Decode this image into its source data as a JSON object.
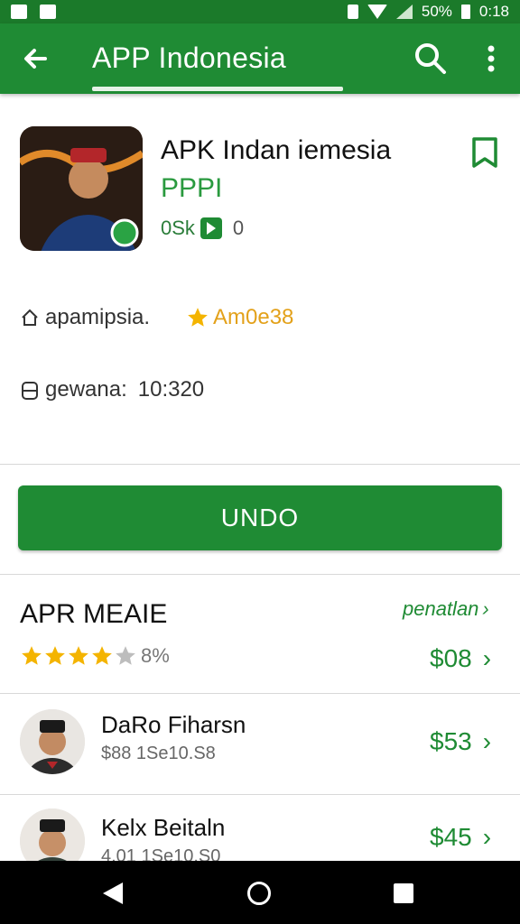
{
  "status_bar": {
    "battery_percent": "50%",
    "time": "0:18"
  },
  "app_bar": {
    "title": "APP Indonesia",
    "icons": [
      "back-arrow-icon",
      "search-icon",
      "more-vert-icon"
    ]
  },
  "app": {
    "name": "APK Indan iemesia",
    "developer": "PPPI",
    "badge_text": "0Sk",
    "badge_count": "0",
    "meta1_label": "apamipsia.",
    "meta1_rating": "Am0e38",
    "meta2_label": "gewana:",
    "meta2_value": "10:320"
  },
  "install_button": {
    "label": "UNDO"
  },
  "reviews_section": {
    "title": "APR MEAIE",
    "link": "penatlan",
    "rating_text": "8%",
    "stars_filled": 4,
    "stars_total": 5,
    "price": "$08"
  },
  "list_items": [
    {
      "name": "DaRo Fiharsn",
      "sub": "$88 1Se10.S8",
      "price": "$53"
    },
    {
      "name": "Kelx Beitaln",
      "sub": "4.01 1Se10.S0",
      "price": "$45"
    }
  ],
  "colors": {
    "primary": "#1f8b34",
    "status_bar": "#1b7a2a",
    "star": "#f4b400",
    "text": "#212121"
  }
}
